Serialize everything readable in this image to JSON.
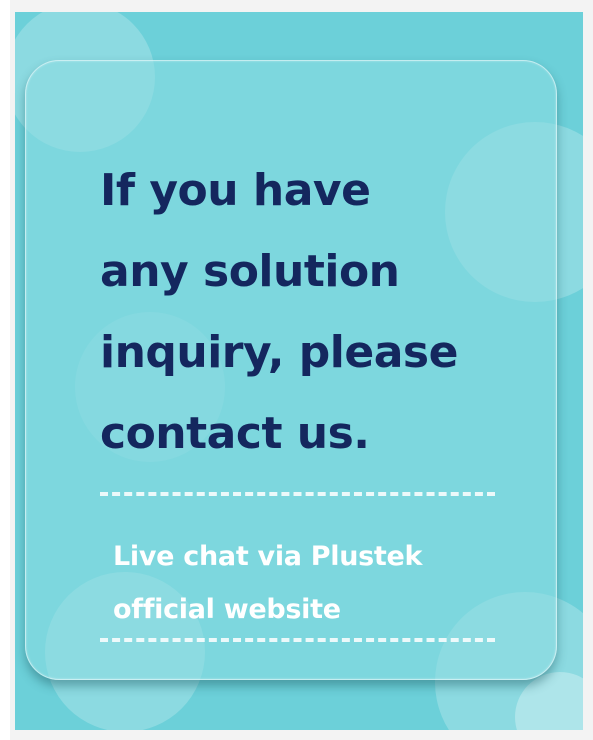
{
  "card": {
    "headline": "If you have\nany solution\ninquiry, please\ncontact us.",
    "subtext": "Live chat via Plustek\nofficial website"
  },
  "colors": {
    "background": "#6cd0d9",
    "headline_text": "#14275e",
    "subtext": "#ffffff"
  }
}
